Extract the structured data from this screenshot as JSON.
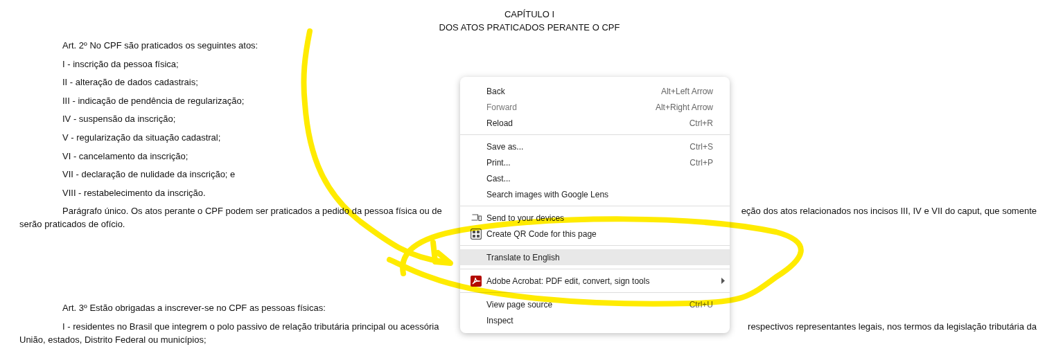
{
  "document": {
    "heading": [
      "CAPÍTULO I",
      "DOS ATOS PRATICADOS PERANTE O CPF"
    ],
    "blocks": [
      {
        "kind": "line",
        "text": "Art. 2º No CPF são praticados os seguintes atos:"
      },
      {
        "kind": "line",
        "text": "I - inscrição da pessoa física;"
      },
      {
        "kind": "line",
        "text": "II - alteração de dados cadastrais;"
      },
      {
        "kind": "line",
        "text": "III - indicação de pendência de regularização;"
      },
      {
        "kind": "line",
        "text": "IV - suspensão da inscrição;"
      },
      {
        "kind": "line",
        "text": "V - regularização da situação cadastral;"
      },
      {
        "kind": "line",
        "text": "VI - cancelamento da inscrição;"
      },
      {
        "kind": "line",
        "text": "VII - declaração de nulidade da inscrição; e"
      },
      {
        "kind": "line",
        "text": "VIII - restabelecimento da inscrição."
      },
      {
        "kind": "split",
        "left": "Parágrafo único. Os atos perante o CPF podem ser praticados a pedido da pessoa física ou de",
        "right": "eção dos atos relacionados nos incisos III, IV e VII do caput, que somente",
        "continuation": "serão praticados de ofício."
      },
      {
        "kind": "line",
        "text": "Art. 3º Estão obrigadas a inscrever-se no CPF as pessoas físicas:"
      },
      {
        "kind": "split",
        "left": "I - residentes no Brasil que integrem o polo passivo de relação tributária principal ou acessória",
        "right": "respectivos representantes legais, nos termos da legislação tributária da",
        "continuation": "União, estados, Distrito Federal ou municípios;"
      }
    ]
  },
  "context_menu": {
    "groups": [
      [
        {
          "label": "Back",
          "shortcut": "Alt+Left Arrow",
          "disabled": false,
          "selected": false
        },
        {
          "label": "Forward",
          "shortcut": "Alt+Right Arrow",
          "disabled": true,
          "selected": false
        },
        {
          "label": "Reload",
          "shortcut": "Ctrl+R",
          "disabled": false,
          "selected": false
        }
      ],
      [
        {
          "label": "Save as...",
          "shortcut": "Ctrl+S",
          "disabled": false,
          "selected": false
        },
        {
          "label": "Print...",
          "shortcut": "Ctrl+P",
          "disabled": false,
          "selected": false
        },
        {
          "label": "Cast...",
          "disabled": false,
          "selected": false
        },
        {
          "label": "Search images with Google Lens",
          "disabled": false,
          "selected": false
        }
      ],
      [
        {
          "label": "Send to your devices",
          "kind": "send",
          "disabled": false,
          "selected": false
        },
        {
          "label": "Create QR Code for this page",
          "kind": "qr",
          "disabled": false,
          "selected": false
        }
      ],
      [
        {
          "label": "Translate to English",
          "disabled": false,
          "selected": true
        }
      ],
      [
        {
          "label": "Adobe Acrobat: PDF edit, convert, sign tools",
          "kind": "extension",
          "submenu": true,
          "disabled": false,
          "selected": false
        }
      ],
      [
        {
          "label": "View page source",
          "shortcut": "Ctrl+U",
          "disabled": false,
          "selected": false
        },
        {
          "label": "Inspect",
          "disabled": false,
          "selected": false
        }
      ]
    ]
  }
}
